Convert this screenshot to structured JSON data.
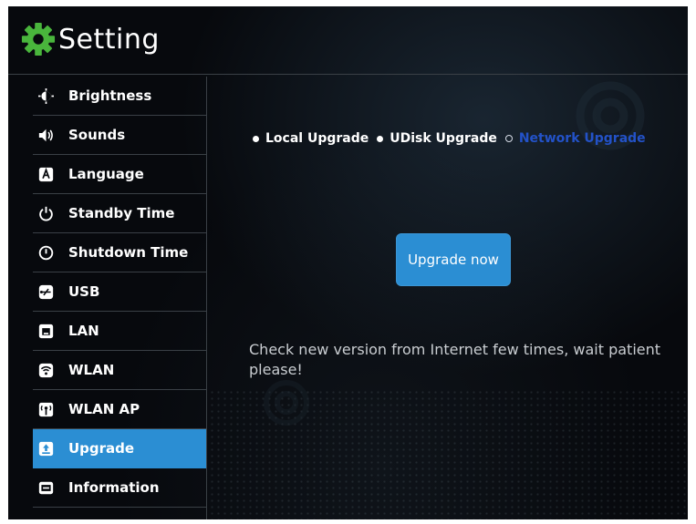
{
  "header": {
    "title": "Setting",
    "icon": "gear-icon",
    "icon_color": "#49b53c"
  },
  "sidebar": {
    "items": [
      {
        "label": "Brightness",
        "icon": "brightness-icon",
        "selected": false
      },
      {
        "label": "Sounds",
        "icon": "speaker-icon",
        "selected": false
      },
      {
        "label": "Language",
        "icon": "language-icon",
        "selected": false
      },
      {
        "label": "Standby Time",
        "icon": "power-icon",
        "selected": false
      },
      {
        "label": "Shutdown Time",
        "icon": "shutdown-icon",
        "selected": false
      },
      {
        "label": "USB",
        "icon": "usb-icon",
        "selected": false
      },
      {
        "label": "LAN",
        "icon": "lan-icon",
        "selected": false
      },
      {
        "label": "WLAN",
        "icon": "wifi-icon",
        "selected": false
      },
      {
        "label": "WLAN AP",
        "icon": "access-point-icon",
        "selected": false
      },
      {
        "label": "Upgrade",
        "icon": "upgrade-icon",
        "selected": true
      },
      {
        "label": "Information",
        "icon": "information-icon",
        "selected": false
      }
    ]
  },
  "main": {
    "tabs": [
      {
        "label": "Local Upgrade",
        "active": false
      },
      {
        "label": "UDisk Upgrade",
        "active": false
      },
      {
        "label": "Network Upgrade",
        "active": true
      }
    ],
    "upgrade_button": "Upgrade now",
    "message": "Check new version from Internet few times, wait patient please!"
  },
  "colors": {
    "background": "#07090d",
    "accent": "#2b8ed3",
    "active_tab": "#2352c8",
    "divider": "#3a4046"
  }
}
